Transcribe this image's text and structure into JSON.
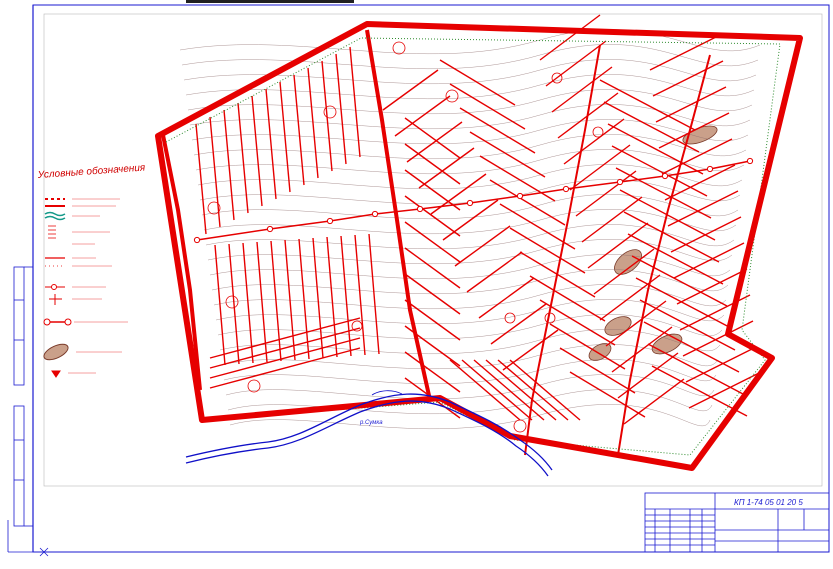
{
  "drawing": {
    "legend_title": "Условные обозначения",
    "river_label": "р.Сумка",
    "stamp_code": "КП 1-74 05 01 20 5"
  },
  "colors": {
    "network": "#e60000",
    "contour": "#8a6a6a",
    "river": "#1010c8",
    "frame": "#1a1ad0",
    "hatch_fill": "#caa08a",
    "boundary_dots": "#2e8b2e"
  }
}
